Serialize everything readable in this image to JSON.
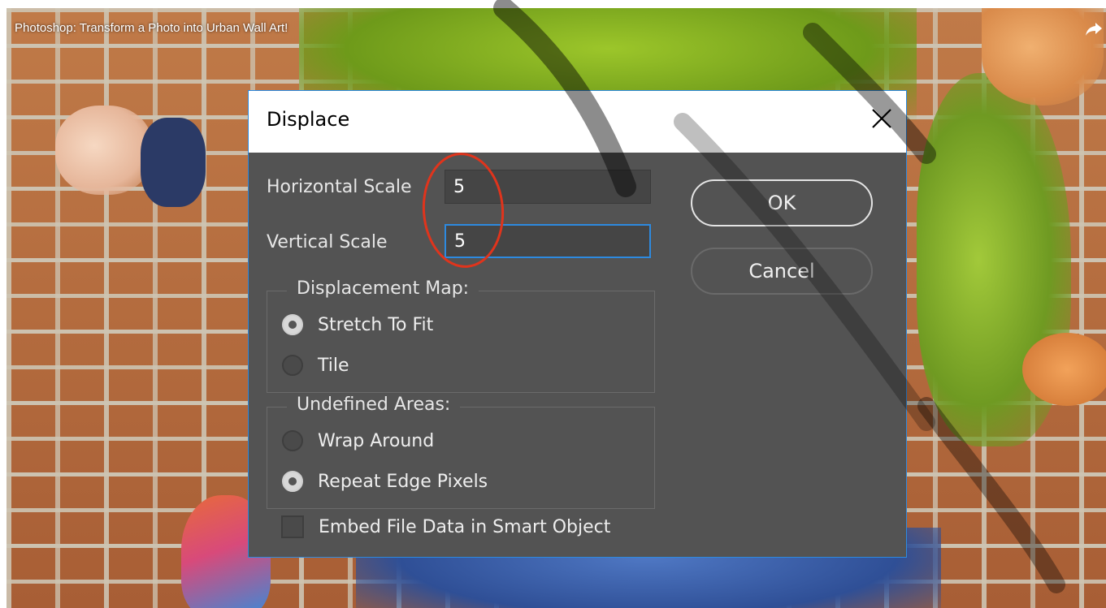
{
  "video": {
    "title": "Photoshop: Transform a Photo into Urban Wall Art!",
    "share_icon": "share-arrow-icon"
  },
  "dialog": {
    "title": "Displace",
    "close_icon": "close-icon",
    "accent_color": "#2d8ae0",
    "horizontal_scale": {
      "label": "Horizontal Scale",
      "value": "5"
    },
    "vertical_scale": {
      "label": "Vertical Scale",
      "value": "5"
    },
    "ok_label": "OK",
    "cancel_label": "Cancel",
    "displacement_map": {
      "legend": "Displacement Map:",
      "options": [
        {
          "label": "Stretch To Fit",
          "checked": true
        },
        {
          "label": "Tile",
          "checked": false
        }
      ]
    },
    "undefined_areas": {
      "legend": "Undefined Areas:",
      "options": [
        {
          "label": "Wrap Around",
          "checked": false
        },
        {
          "label": "Repeat Edge Pixels",
          "checked": true
        }
      ]
    },
    "embed_checkbox": {
      "label": "Embed File Data in Smart Object",
      "checked": false
    }
  },
  "annotation_color": "#e0341c"
}
